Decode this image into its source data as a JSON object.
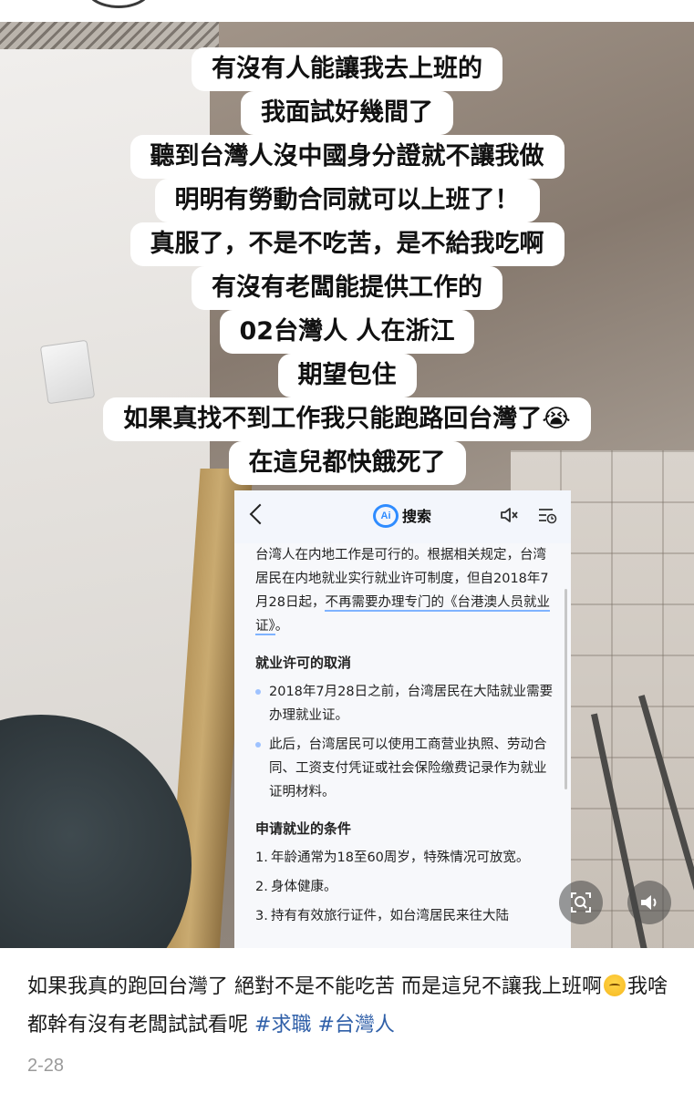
{
  "captions": [
    "有沒有人能讓我去上班的",
    "我面試好幾間了",
    "聽到台灣人沒中國身分證就不讓我做",
    "明明有勞動合同就可以上班了！",
    "真服了，不是不吃苦，是不給我吃啊",
    "有沒有老闆能提供工作的",
    "02台灣人 人在浙江",
    "期望包住",
    "如果真找不到工作我只能跑路回台灣了😭",
    "在這兒都快餓死了"
  ],
  "ai_screen": {
    "logo_text": "Ai",
    "title": "搜索",
    "intro_a": "台湾人在内地工作是可行的。根据相关规定，台湾居民在内地就业实行就业许可制度，但自2018年7月28日起，",
    "intro_b": "不再需要办理专门的《台港澳人员就业证》",
    "intro_c": "。",
    "section1_title": "就业许可的取消",
    "section1_items": [
      "2018年7月28日之前，台湾居民在大陆就业需要办理就业证。",
      "此后，台湾居民可以使用工商营业执照、劳动合同、工资支付凭证或社会保险缴费记录作为就业证明材料。"
    ],
    "section2_title": "申请就业的条件",
    "section2_items": [
      {
        "num": "1.",
        "text": "年龄通常为18至60周岁，特殊情况可放宽。"
      },
      {
        "num": "2.",
        "text": "身体健康。"
      },
      {
        "num": "3.",
        "text": "持有有效旅行证件，如台湾居民来往大陆"
      }
    ]
  },
  "post": {
    "text_a": "如果我真的跑回台灣了 絕對不是不能吃苦 而是這兒不讓我上班啊",
    "text_b": "我啥都幹有沒有老闆試試看呢",
    "hashtag_1": "#求職",
    "hashtag_2": "#台灣人",
    "date": "2-28"
  },
  "icons": {
    "lens": "image-search-icon",
    "volume": "volume-icon",
    "emoji": "pensive-face-emoji"
  },
  "colors": {
    "hashtag": "#2f5fa8",
    "ai_accent": "#2f8cff",
    "date": "#9a9a9a"
  }
}
